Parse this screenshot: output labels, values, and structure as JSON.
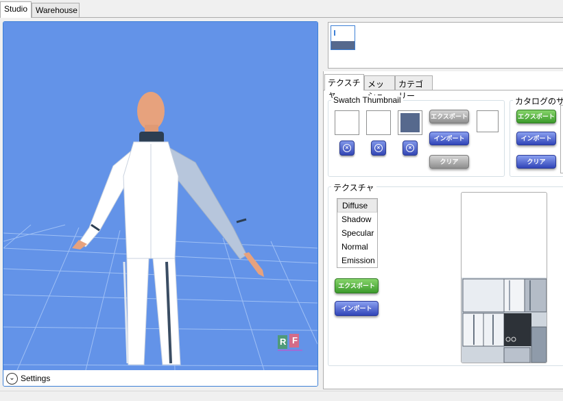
{
  "top_tabs": {
    "studio": "Studio",
    "warehouse": "Warehouse"
  },
  "viewport": {
    "settings_label": "Settings",
    "logo_letters": [
      "R",
      "F"
    ]
  },
  "sub_tabs": {
    "texture": "テクスチャ",
    "mesh": "メッシュ",
    "category": "カテゴリー"
  },
  "swatch_group": {
    "title": "Swatch Thumbnail",
    "export_label": "エクスポート",
    "import_label": "インポート",
    "clear_label": "クリア",
    "swatch_fill_color": "#56698d"
  },
  "catalog_group": {
    "title": "カタログのサムネ",
    "export_label": "エクスポート",
    "import_label": "インポート",
    "clear_label": "クリア"
  },
  "texture_group": {
    "title": "テクスチャ",
    "items": [
      "Diffuse",
      "Shadow",
      "Specular",
      "Normal",
      "Emission"
    ],
    "selected": "Diffuse",
    "export_label": "エクスポート",
    "import_label": "インポート"
  },
  "colors": {
    "scene_bg": "#6393e8",
    "accent": "#3c7fd6",
    "green_button": "#3c9a2c",
    "blue_button": "#3145b8"
  }
}
